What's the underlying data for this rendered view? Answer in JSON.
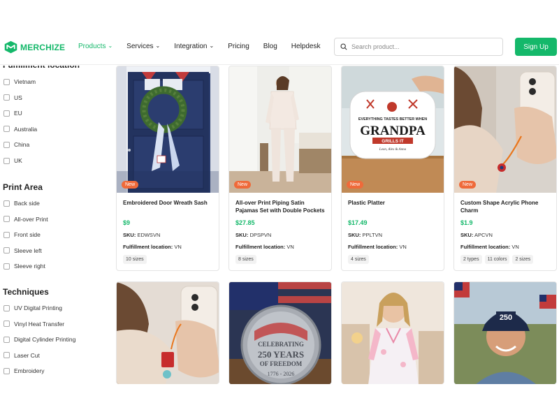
{
  "brand": {
    "name": "MERCHIZE",
    "accent": "#14b86a"
  },
  "nav": [
    {
      "label": "Products",
      "has_dropdown": true,
      "active": true
    },
    {
      "label": "Services",
      "has_dropdown": true,
      "active": false
    },
    {
      "label": "Integration",
      "has_dropdown": true,
      "active": false
    },
    {
      "label": "Pricing",
      "has_dropdown": false,
      "active": false
    },
    {
      "label": "Blog",
      "has_dropdown": false,
      "active": false
    },
    {
      "label": "Helpdesk",
      "has_dropdown": false,
      "active": false
    }
  ],
  "search": {
    "placeholder": "Search product..."
  },
  "signup_label": "Sign Up",
  "sidebar": {
    "fulfillment_title": "Fulfillment location",
    "fulfillment": [
      "Vietnam",
      "US",
      "EU",
      "Australia",
      "China",
      "UK"
    ],
    "print_area_title": "Print Area",
    "print_area": [
      "Back side",
      "All-over Print",
      "Front side",
      "Sleeve left",
      "Sleeve right"
    ],
    "techniques_title": "Techniques",
    "techniques": [
      "UV Digital Printing",
      "Vinyl Heat Transfer",
      "Digital Cylinder Printing",
      "Laser Cut",
      "Embroidery"
    ]
  },
  "labels": {
    "sku": "SKU:",
    "location": "Fulfillment location:",
    "new_badge": "New"
  },
  "products": [
    {
      "name": "Embroidered Door Wreath Sash",
      "price": "$9",
      "sku": "EDWSVN",
      "location": "VN",
      "tags": [
        "10 sizes"
      ],
      "is_new": true
    },
    {
      "name": "All-over Print Piping Satin Pajamas Set with Double Pockets",
      "price": "$27.85",
      "sku": "DPSPVN",
      "location": "VN",
      "tags": [
        "8 sizes"
      ],
      "is_new": true
    },
    {
      "name": "Plastic Platter",
      "price": "$17.49",
      "sku": "PPLTVN",
      "location": "VN",
      "tags": [
        "4 sizes"
      ],
      "is_new": true,
      "image_text": [
        "EVERYTHING TASTES BETTER WHEN",
        "GRANDPA",
        "GRILLS IT",
        "Leon, Alex & Anna"
      ]
    },
    {
      "name": "Custom Shape Acrylic Phone Charm",
      "price": "$1.9",
      "sku": "APCVN",
      "location": "VN",
      "tags": [
        "2 types",
        "11 colors",
        "2 sizes"
      ],
      "is_new": true
    }
  ],
  "row2_image_text": {
    "coin": [
      "CELEBRATING",
      "250 YEARS",
      "OF FREEDOM",
      "1776 - 2026"
    ],
    "cap": "250"
  }
}
